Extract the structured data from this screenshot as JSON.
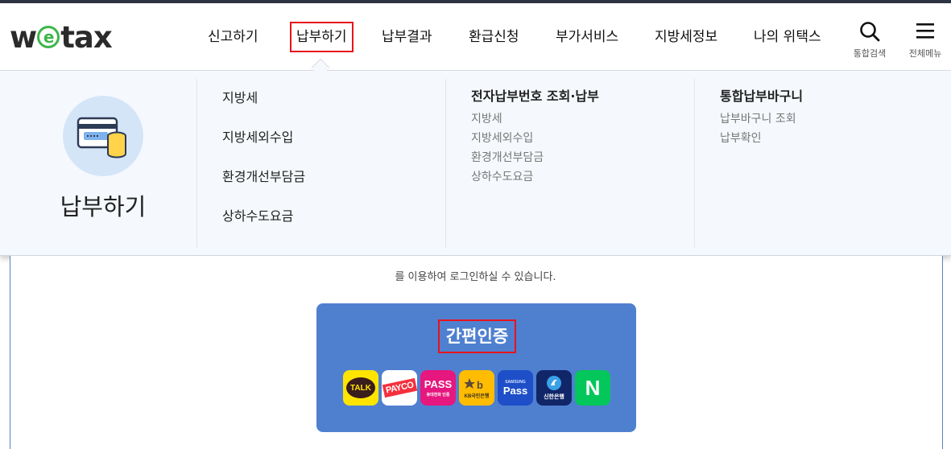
{
  "logo": {
    "pre": "w",
    "e": "e",
    "post": "tax"
  },
  "nav": {
    "items": [
      {
        "label": "신고하기"
      },
      {
        "label": "납부하기"
      },
      {
        "label": "납부결과"
      },
      {
        "label": "환급신청"
      },
      {
        "label": "부가서비스"
      },
      {
        "label": "지방세정보"
      },
      {
        "label": "나의 위택스"
      }
    ],
    "active": "납부하기"
  },
  "utilities": {
    "search_label": "통합검색",
    "menu_label": "전체메뉴"
  },
  "mega_menu": {
    "title": "납부하기",
    "col1": {
      "items": [
        "지방세",
        "지방세외수입",
        "환경개선부담금",
        "상하수도요금"
      ]
    },
    "col2": {
      "heading": "전자납부번호 조회·납부",
      "items": [
        "지방세",
        "지방세외수입",
        "환경개선부담금",
        "상하수도요금"
      ]
    },
    "col3": {
      "heading": "통합납부바구니",
      "items": [
        "납부바구니 조회",
        "납부확인"
      ]
    }
  },
  "login": {
    "notice": "를 이용하여 로그인하실 수 있습니다.",
    "easy_auth_title": "간편인증",
    "providers": {
      "talk": "TALK",
      "payco": "PAYCO",
      "pass": "PASS",
      "pass_sub": "휴대전화 인증",
      "kb_sub": "KB국민은행",
      "samsung_top": "SAMSUNG",
      "samsung_main": "Pass",
      "shinhan": "신한은행",
      "naver": "N"
    }
  },
  "colors": {
    "accent_red": "#e8131b",
    "easy_auth_bg": "#4f80d0",
    "logo_green": "#3db54a",
    "mega_bg": "#f5f9fd"
  }
}
